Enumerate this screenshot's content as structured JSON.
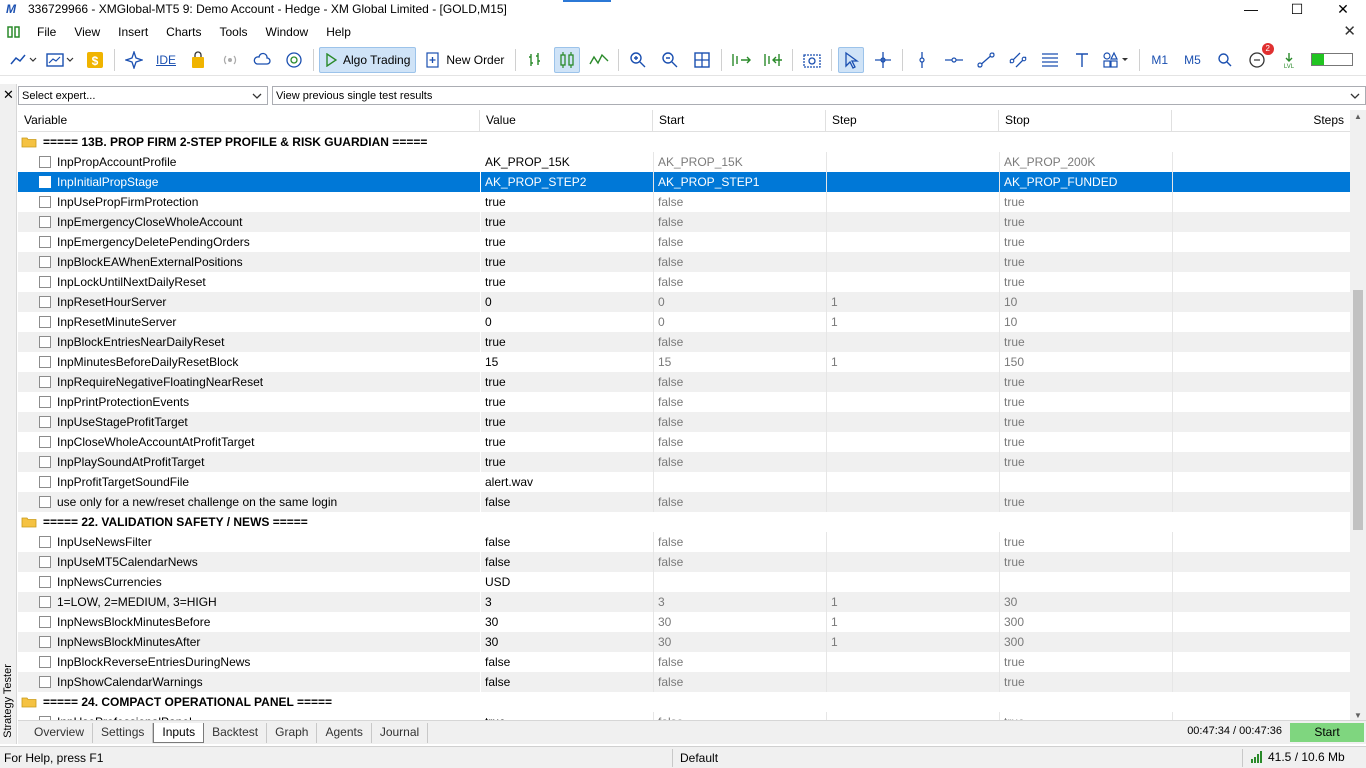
{
  "window": {
    "title": "336729966 - XMGlobal-MT5 9: Demo Account - Hedge - XM Global Limited - [GOLD,M15]",
    "logo_text": "M",
    "controls": [
      "—",
      "☐",
      "✕"
    ]
  },
  "menu": {
    "items": [
      "File",
      "View",
      "Insert",
      "Charts",
      "Tools",
      "Window",
      "Help"
    ],
    "close_glyph": "✕"
  },
  "toolbar": {
    "ide_label": "IDE",
    "algo_trading_label": "Algo Trading",
    "new_order_label": "New Order",
    "timeframe_m1": "M1",
    "timeframe_m5": "M5",
    "notification_count": "2",
    "level_fraction": 0.3,
    "colors": {
      "accent": "#0078d7",
      "green": "#21c421",
      "gold": "#f0b400"
    }
  },
  "tester": {
    "side_label": "Strategy Tester",
    "close_glyph": "✕",
    "expert_select": "Select expert...",
    "results_select": "View previous single test results",
    "columns": [
      "Variable",
      "Value",
      "Start",
      "Step",
      "Stop",
      "Steps"
    ],
    "rows": [
      {
        "type": "group",
        "name": "===== 13B. PROP FIRM 2-STEP PROFILE & RISK GUARDIAN ====="
      },
      {
        "name": "InpPropAccountProfile",
        "value": "AK_PROP_15K",
        "start": "AK_PROP_15K",
        "step": "",
        "stop": "AK_PROP_200K"
      },
      {
        "name": "InpInitialPropStage",
        "value": "AK_PROP_STEP2",
        "start": "AK_PROP_STEP1",
        "step": "",
        "stop": "AK_PROP_FUNDED",
        "selected": true
      },
      {
        "name": "InpUsePropFirmProtection",
        "value": "true",
        "start": "false",
        "step": "",
        "stop": "true"
      },
      {
        "name": "InpEmergencyCloseWholeAccount",
        "value": "true",
        "start": "false",
        "step": "",
        "stop": "true"
      },
      {
        "name": "InpEmergencyDeletePendingOrders",
        "value": "true",
        "start": "false",
        "step": "",
        "stop": "true"
      },
      {
        "name": "InpBlockEAWhenExternalPositions",
        "value": "true",
        "start": "false",
        "step": "",
        "stop": "true"
      },
      {
        "name": "InpLockUntilNextDailyReset",
        "value": "true",
        "start": "false",
        "step": "",
        "stop": "true"
      },
      {
        "name": "InpResetHourServer",
        "value": "0",
        "start": "0",
        "step": "1",
        "stop": "10"
      },
      {
        "name": "InpResetMinuteServer",
        "value": "0",
        "start": "0",
        "step": "1",
        "stop": "10"
      },
      {
        "name": "InpBlockEntriesNearDailyReset",
        "value": "true",
        "start": "false",
        "step": "",
        "stop": "true"
      },
      {
        "name": "InpMinutesBeforeDailyResetBlock",
        "value": "15",
        "start": "15",
        "step": "1",
        "stop": "150"
      },
      {
        "name": "InpRequireNegativeFloatingNearReset",
        "value": "true",
        "start": "false",
        "step": "",
        "stop": "true"
      },
      {
        "name": "InpPrintProtectionEvents",
        "value": "true",
        "start": "false",
        "step": "",
        "stop": "true"
      },
      {
        "name": "InpUseStageProfitTarget",
        "value": "true",
        "start": "false",
        "step": "",
        "stop": "true"
      },
      {
        "name": "InpCloseWholeAccountAtProfitTarget",
        "value": "true",
        "start": "false",
        "step": "",
        "stop": "true"
      },
      {
        "name": "InpPlaySoundAtProfitTarget",
        "value": "true",
        "start": "false",
        "step": "",
        "stop": "true"
      },
      {
        "name": "InpProfitTargetSoundFile",
        "value": "alert.wav",
        "start": "",
        "step": "",
        "stop": ""
      },
      {
        "name": "use only for a new/reset challenge on the same login",
        "value": "false",
        "start": "false",
        "step": "",
        "stop": "true"
      },
      {
        "type": "group",
        "name": "===== 22. VALIDATION SAFETY / NEWS ====="
      },
      {
        "name": "InpUseNewsFilter",
        "value": "false",
        "start": "false",
        "step": "",
        "stop": "true"
      },
      {
        "name": "InpUseMT5CalendarNews",
        "value": "false",
        "start": "false",
        "step": "",
        "stop": "true"
      },
      {
        "name": "InpNewsCurrencies",
        "value": "USD",
        "start": "",
        "step": "",
        "stop": ""
      },
      {
        "name": "1=LOW, 2=MEDIUM, 3=HIGH",
        "value": "3",
        "start": "3",
        "step": "1",
        "stop": "30"
      },
      {
        "name": "InpNewsBlockMinutesBefore",
        "value": "30",
        "start": "30",
        "step": "1",
        "stop": "300"
      },
      {
        "name": "InpNewsBlockMinutesAfter",
        "value": "30",
        "start": "30",
        "step": "1",
        "stop": "300"
      },
      {
        "name": "InpBlockReverseEntriesDuringNews",
        "value": "false",
        "start": "false",
        "step": "",
        "stop": "true"
      },
      {
        "name": "InpShowCalendarWarnings",
        "value": "false",
        "start": "false",
        "step": "",
        "stop": "true"
      },
      {
        "type": "group",
        "name": "===== 24. COMPACT OPERATIONAL PANEL ====="
      },
      {
        "name": "InpUseProfessionalPanel",
        "value": "true",
        "start": "false",
        "step": "",
        "stop": "true"
      }
    ],
    "tabs": [
      "Overview",
      "Settings",
      "Inputs",
      "Backtest",
      "Graph",
      "Agents",
      "Journal"
    ],
    "active_tab": "Inputs",
    "timer": "00:47:34 / 00:47:36",
    "start_label": "Start"
  },
  "status": {
    "help": "For Help, press F1",
    "profile": "Default",
    "traffic": "41.5 / 10.6 Mb"
  }
}
